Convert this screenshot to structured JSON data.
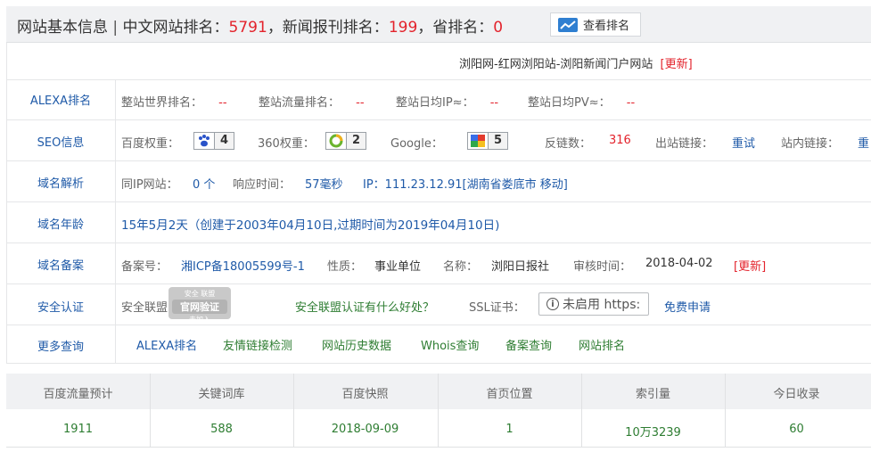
{
  "header": {
    "title": "网站基本信息",
    "sep": "|",
    "cn_rank_label": "中文网站排名：",
    "cn_rank_value": "5791",
    "news_rank_label": "，新闻报刊排名：",
    "news_rank_value": "199",
    "prov_rank_label": "，省排名：",
    "prov_rank_value": "0",
    "view_rank_button": "查看排名"
  },
  "site": {
    "subtitle": "浏阳网-红网浏阳站-浏阳新闻门户网站",
    "update_link": "[更新]"
  },
  "alexa": {
    "label": "ALEXA排名",
    "world_rank_label": "整站世界排名：",
    "world_rank_value": "--",
    "traffic_rank_label": "整站流量排名：",
    "traffic_rank_value": "--",
    "daily_ip_label": "整站日均IP≈：",
    "daily_ip_value": "--",
    "daily_pv_label": "整站日均PV≈：",
    "daily_pv_value": "--"
  },
  "seo": {
    "label": "SEO信息",
    "baidu_label": "百度权重：",
    "baidu_value": "4",
    "so360_label": "360权重：",
    "so360_value": "2",
    "google_label": "Google：",
    "google_value": "5",
    "backlinks_label": "反链数：",
    "backlinks_value": "316",
    "outlinks_label": "出站链接：",
    "outlinks_value": "重试",
    "inlinks_label": "站内链接：",
    "inlinks_value": "重"
  },
  "dns": {
    "label": "域名解析",
    "same_ip_label": "同IP网站：",
    "same_ip_value": "0 个",
    "resp_label": "响应时间：",
    "resp_value": "57毫秒",
    "ip_text": "IP：111.23.12.91[湖南省娄底市 移动]"
  },
  "age": {
    "label": "域名年龄",
    "text": "15年5月2天（创建于2003年04月10日,过期时间为2019年04月10日)"
  },
  "icp": {
    "label": "域名备案",
    "no_label": "备案号：",
    "no_value": "湘ICP备18005599号-1",
    "nature_label": "性质：",
    "nature_value": "事业单位",
    "name_label": "名称：",
    "name_value": "浏阳日报社",
    "audit_label": "审核时间：",
    "audit_value": "2018-04-02",
    "update_link": "[更新]"
  },
  "security": {
    "label": "安全认证",
    "alliance_label": "安全联盟：",
    "seal_top": "安全 联盟",
    "seal_mid": "官网验证",
    "seal_bottom": "未加入",
    "alliance_question": "安全联盟认证有什么好处？",
    "ssl_label": "SSL证书：",
    "ssl_button": "未启用 https:",
    "free_apply": "免费申请"
  },
  "more": {
    "label": "更多查询",
    "links": [
      "ALEXA排名",
      "友情链接检测",
      "网站历史数据",
      "Whois查询",
      "备案查询",
      "网站排名"
    ]
  },
  "stats": {
    "headers": [
      "百度流量预计",
      "关键词库",
      "百度快照",
      "首页位置",
      "索引量",
      "今日收录"
    ],
    "values": [
      "1911",
      "588",
      "2018-09-09",
      "1",
      "10万3239",
      "60"
    ]
  },
  "colors": {
    "link_blue": "#1f5aa8",
    "value_red": "#e3232c",
    "value_green": "#2e7d32",
    "header_bg": "#f0f1f3"
  }
}
